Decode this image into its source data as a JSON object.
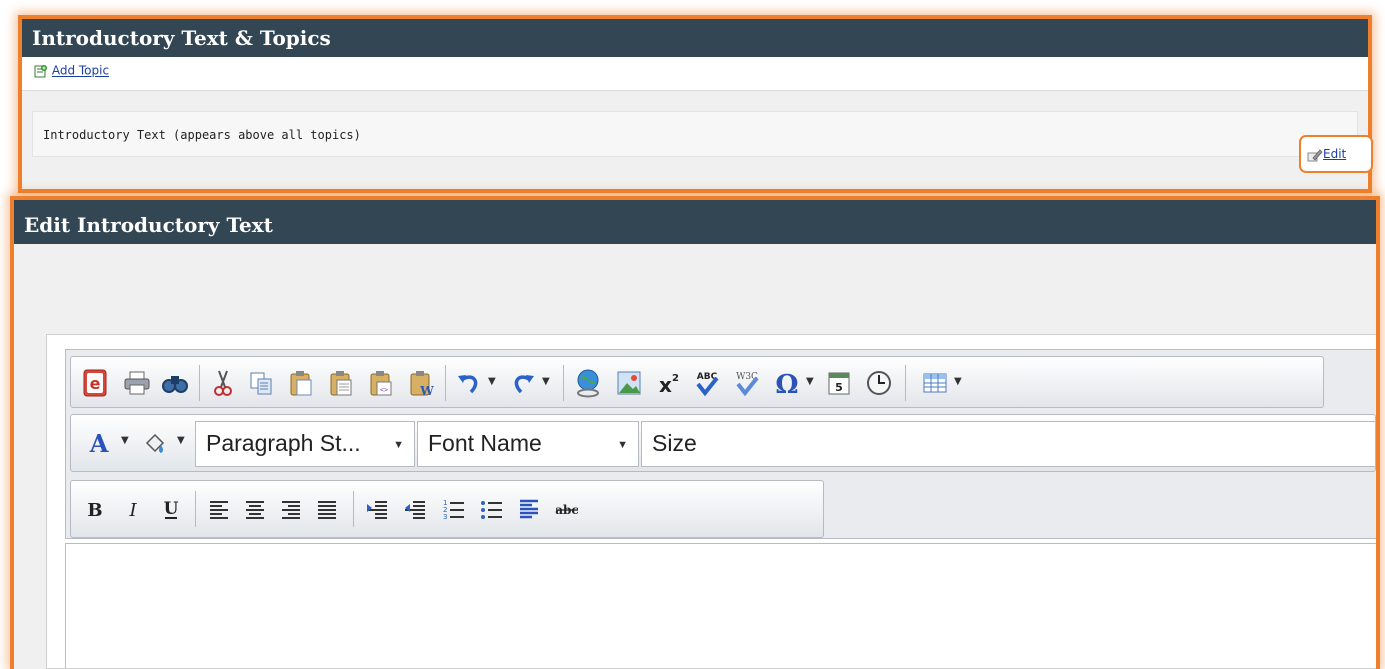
{
  "top_panel": {
    "title": "Introductory Text & Topics",
    "add_topic_label": "Add Topic",
    "intro_text_label": "Introductory Text (appears above all topics)",
    "edit_label": "Edit"
  },
  "bottom_panel": {
    "title": "Edit Introductory Text"
  },
  "toolbar": {
    "paragraph_style": "Paragraph St...",
    "font_name": "Font Name",
    "size": "Size"
  },
  "colors": {
    "highlight": "#ee7f2d",
    "header_bg": "#334653",
    "link": "#1a3ea8"
  },
  "icons": {
    "row1": [
      "editor-logo-icon",
      "print-icon",
      "find-icon",
      "cut-icon",
      "copy-icon",
      "paste-icon",
      "paste-plain-icon",
      "paste-html-icon",
      "paste-word-icon",
      "undo-icon",
      "redo-icon",
      "hyperlink-icon",
      "image-icon",
      "superscript-icon",
      "spellcheck-icon",
      "w3c-validate-icon",
      "special-chars-icon",
      "insert-date-icon",
      "insert-time-icon",
      "insert-table-icon"
    ],
    "row2": [
      "font-color-icon",
      "highlight-color-icon"
    ],
    "row3": [
      "bold-icon",
      "italic-icon",
      "underline-icon",
      "align-left-icon",
      "align-center-icon",
      "align-right-icon",
      "justify-icon",
      "outdent-icon",
      "indent-icon",
      "numbered-list-icon",
      "bullet-list-icon",
      "paragraph-icon",
      "strikethrough-icon"
    ]
  }
}
